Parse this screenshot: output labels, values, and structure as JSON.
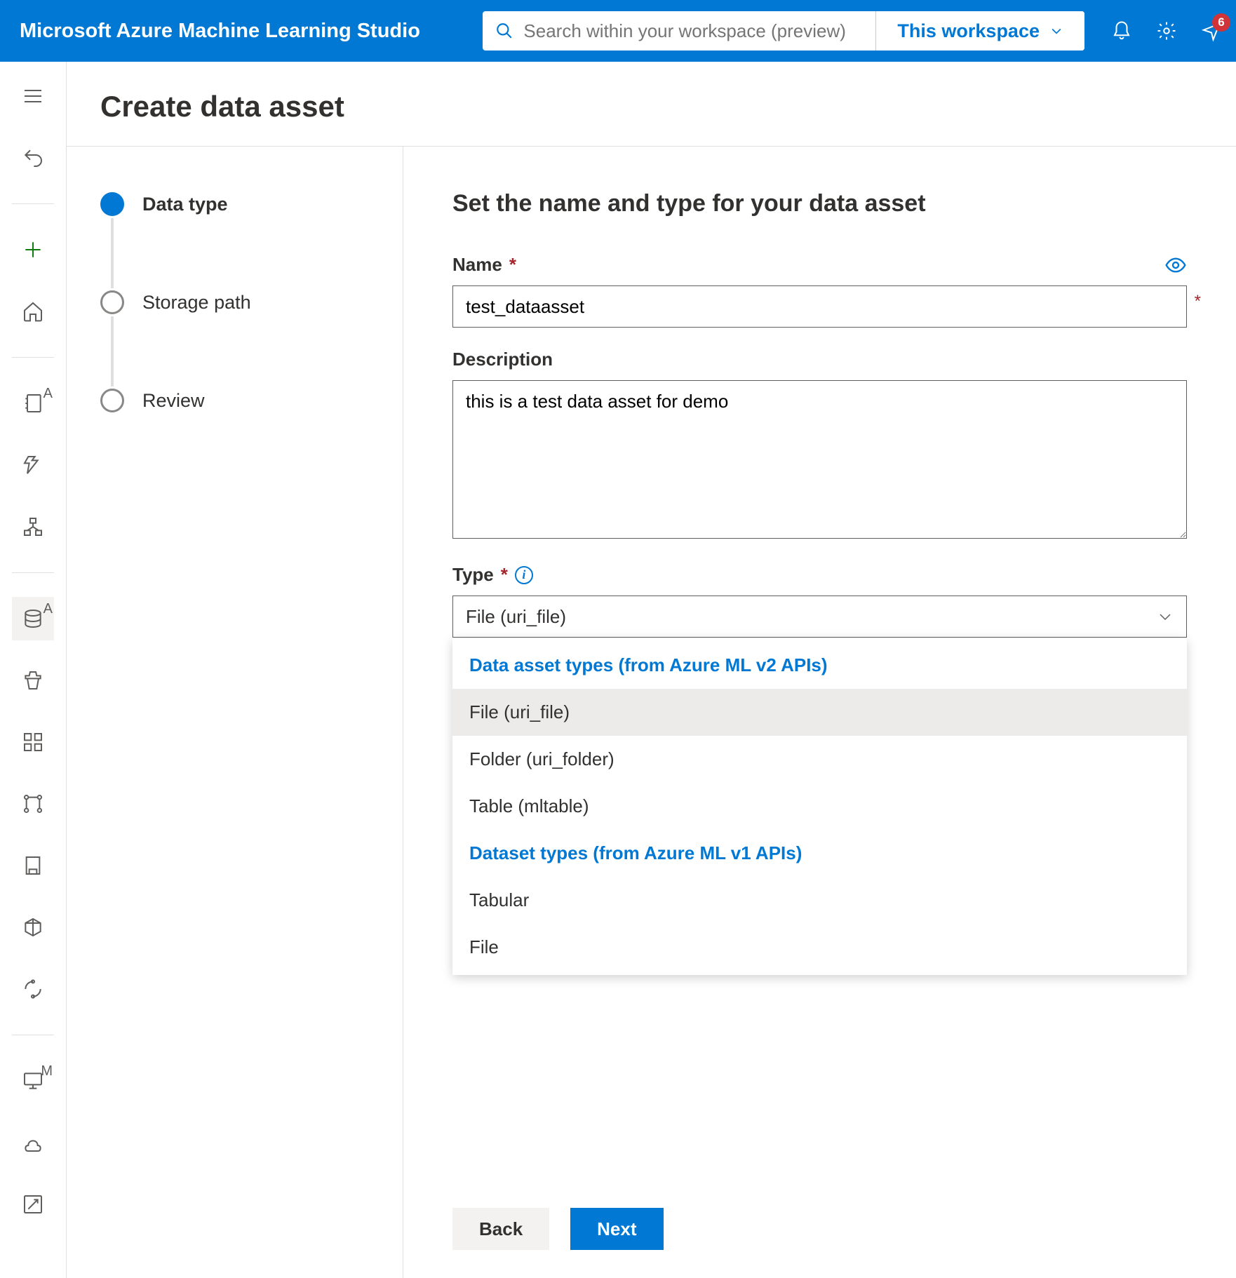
{
  "topbar": {
    "title": "Microsoft Azure Machine Learning Studio",
    "search_placeholder": "Search within your workspace (preview)",
    "workspace_label": "This workspace",
    "notification_count": "6"
  },
  "page": {
    "title": "Create data asset"
  },
  "steps": {
    "s1": "Data type",
    "s2": "Storage path",
    "s3": "Review"
  },
  "form": {
    "heading": "Set the name and type for your data asset",
    "name_label": "Name",
    "name_value": "test_dataasset",
    "desc_label": "Description",
    "desc_value": "this is a test data asset for demo",
    "type_label": "Type",
    "type_selected": "File (uri_file)",
    "dropdown": {
      "group1": "Data asset types (from Azure ML v2 APIs)",
      "opt1": "File (uri_file)",
      "opt2": "Folder (uri_folder)",
      "opt3": "Table (mltable)",
      "group2": "Dataset types (from Azure ML v1 APIs)",
      "opt4": "Tabular",
      "opt5": "File"
    }
  },
  "footer": {
    "back": "Back",
    "next": "Next"
  },
  "leftnav_letters": {
    "a1": "A",
    "a2": "A",
    "m": "M"
  }
}
